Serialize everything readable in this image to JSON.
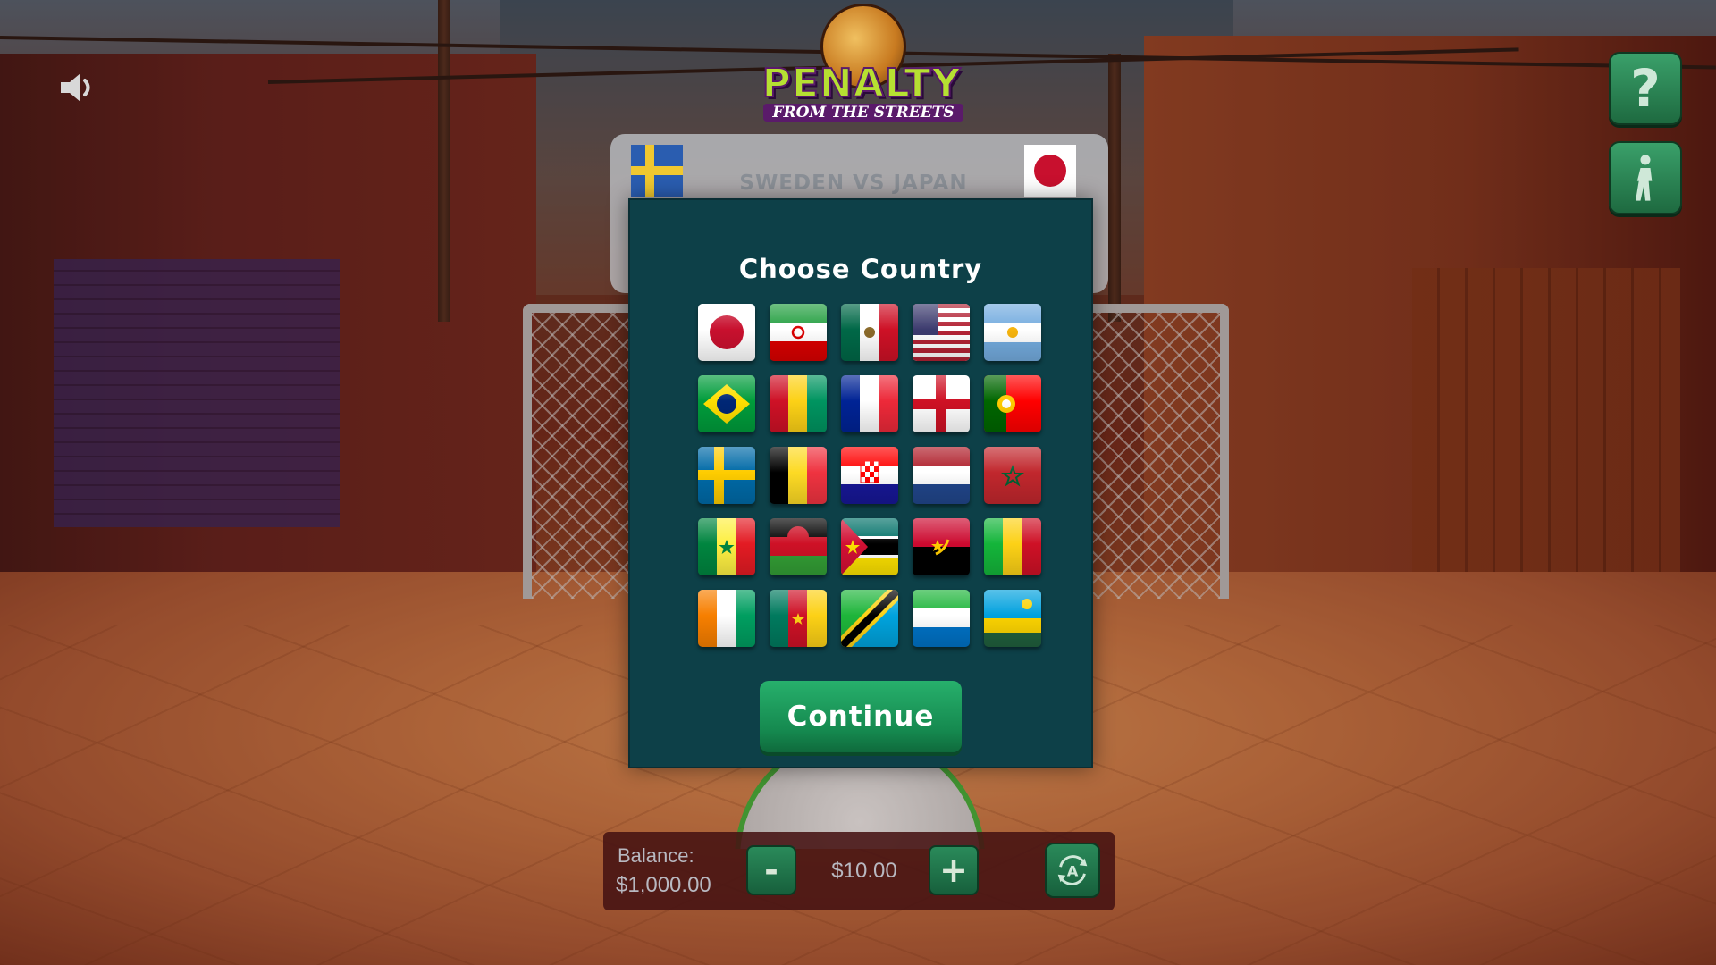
{
  "game": {
    "logo_title": "PENALTY",
    "logo_subtitle": "FROM THE STREETS"
  },
  "controls": {
    "sound_icon": "speaker-icon",
    "help_label": "?",
    "walk_icon": "walking-person-icon"
  },
  "match": {
    "title": "SWEDEN VS JAPAN",
    "home_flag": "sweden-flag",
    "away_flag": "japan-flag"
  },
  "modal": {
    "title": "Choose Country",
    "continue_label": "Continue",
    "flags": [
      "japan",
      "iran",
      "mexico",
      "usa",
      "argentina",
      "brazil",
      "guinea",
      "france",
      "england",
      "portugal",
      "sweden",
      "belgium",
      "croatia",
      "netherlands",
      "morocco",
      "senegal",
      "malawi",
      "mozambique",
      "angola",
      "mali",
      "ivory-coast",
      "cameroon",
      "tanzania",
      "sierra-leone",
      "rwanda"
    ]
  },
  "bet_bar": {
    "balance_label": "Balance:",
    "balance_value": "$1,000.00",
    "minus_label": "-",
    "bet_amount": "$10.00",
    "plus_label": "+",
    "auto_icon": "auto-play-icon"
  },
  "colors": {
    "modal_bg": "#0d4048",
    "button_green": "#15894f",
    "logo_green": "#b6e032",
    "logo_purple": "#5a1a6a"
  }
}
